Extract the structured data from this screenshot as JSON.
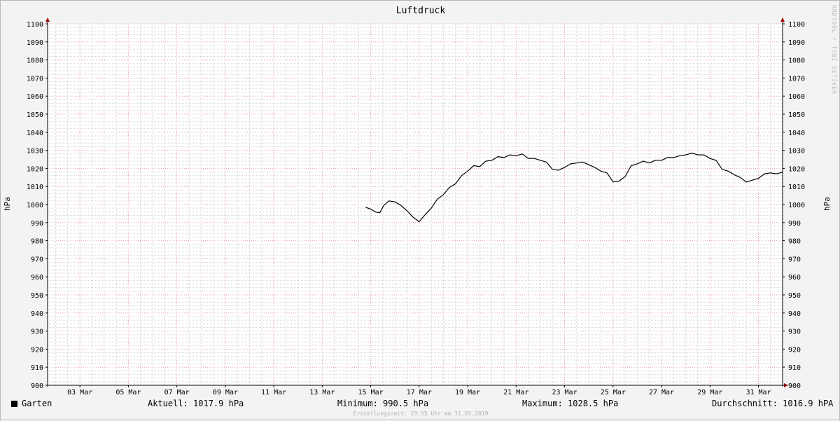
{
  "chart_data": {
    "type": "line",
    "title": "Luftdruck",
    "ylabel": "hPa",
    "ylim": [
      900,
      1100
    ],
    "yticks": [
      900,
      910,
      920,
      930,
      940,
      950,
      960,
      970,
      980,
      990,
      1000,
      1010,
      1020,
      1030,
      1040,
      1050,
      1060,
      1070,
      1080,
      1090,
      1100
    ],
    "xlim": [
      "2019-03-01 16:00",
      "2019-03-31 23:55"
    ],
    "xticks": [
      {
        "label": "03 Mar",
        "date": "2019-03-03"
      },
      {
        "label": "05 Mar",
        "date": "2019-03-05"
      },
      {
        "label": "07 Mar",
        "date": "2019-03-07"
      },
      {
        "label": "09 Mar",
        "date": "2019-03-09"
      },
      {
        "label": "11 Mar",
        "date": "2019-03-11"
      },
      {
        "label": "13 Mar",
        "date": "2019-03-13"
      },
      {
        "label": "15 Mar",
        "date": "2019-03-15"
      },
      {
        "label": "17 Mar",
        "date": "2019-03-17"
      },
      {
        "label": "19 Mar",
        "date": "2019-03-19"
      },
      {
        "label": "21 Mar",
        "date": "2019-03-21"
      },
      {
        "label": "23 Mar",
        "date": "2019-03-23"
      },
      {
        "label": "25 Mar",
        "date": "2019-03-25"
      },
      {
        "label": "27 Mar",
        "date": "2019-03-27"
      },
      {
        "label": "29 Mar",
        "date": "2019-03-29"
      },
      {
        "label": "31 Mar",
        "date": "2019-03-31"
      }
    ],
    "grid": true,
    "series": [
      {
        "name": "Garten",
        "color": "#000000",
        "points": [
          [
            "2019-03-14 19:00",
            998.5
          ],
          [
            "2019-03-15 00:00",
            997.5
          ],
          [
            "2019-03-15 05:00",
            995.8
          ],
          [
            "2019-03-15 09:00",
            995.5
          ],
          [
            "2019-03-15 13:00",
            999.5
          ],
          [
            "2019-03-15 18:00",
            1002.0
          ],
          [
            "2019-03-16 00:00",
            1001.5
          ],
          [
            "2019-03-16 06:00",
            999.5
          ],
          [
            "2019-03-16 12:00",
            996.5
          ],
          [
            "2019-03-16 18:00",
            993.0
          ],
          [
            "2019-03-17 00:00",
            990.5
          ],
          [
            "2019-03-17 06:00",
            994.5
          ],
          [
            "2019-03-17 12:00",
            998.0
          ],
          [
            "2019-03-17 18:00",
            1003.0
          ],
          [
            "2019-03-18 00:00",
            1005.5
          ],
          [
            "2019-03-18 06:00",
            1009.5
          ],
          [
            "2019-03-18 12:00",
            1011.5
          ],
          [
            "2019-03-18 18:00",
            1016.0
          ],
          [
            "2019-03-19 00:00",
            1018.5
          ],
          [
            "2019-03-19 06:00",
            1021.5
          ],
          [
            "2019-03-19 12:00",
            1021.0
          ],
          [
            "2019-03-19 18:00",
            1024.0
          ],
          [
            "2019-03-20 00:00",
            1024.5
          ],
          [
            "2019-03-20 06:00",
            1026.5
          ],
          [
            "2019-03-20 12:00",
            1026.0
          ],
          [
            "2019-03-20 18:00",
            1027.5
          ],
          [
            "2019-03-21 00:00",
            1027.0
          ],
          [
            "2019-03-21 06:00",
            1028.0
          ],
          [
            "2019-03-21 12:00",
            1025.5
          ],
          [
            "2019-03-21 18:00",
            1025.5
          ],
          [
            "2019-03-22 00:00",
            1024.5
          ],
          [
            "2019-03-22 06:00",
            1023.5
          ],
          [
            "2019-03-22 12:00",
            1019.5
          ],
          [
            "2019-03-22 18:00",
            1019.0
          ],
          [
            "2019-03-23 00:00",
            1020.5
          ],
          [
            "2019-03-23 06:00",
            1022.5
          ],
          [
            "2019-03-23 12:00",
            1023.0
          ],
          [
            "2019-03-23 18:00",
            1023.5
          ],
          [
            "2019-03-24 00:00",
            1022.0
          ],
          [
            "2019-03-24 06:00",
            1020.5
          ],
          [
            "2019-03-24 12:00",
            1018.5
          ],
          [
            "2019-03-24 18:00",
            1017.5
          ],
          [
            "2019-03-25 00:00",
            1012.5
          ],
          [
            "2019-03-25 06:00",
            1013.0
          ],
          [
            "2019-03-25 12:00",
            1015.5
          ],
          [
            "2019-03-25 18:00",
            1021.5
          ],
          [
            "2019-03-26 00:00",
            1022.5
          ],
          [
            "2019-03-26 06:00",
            1024.0
          ],
          [
            "2019-03-26 12:00",
            1023.0
          ],
          [
            "2019-03-26 18:00",
            1024.5
          ],
          [
            "2019-03-27 00:00",
            1024.5
          ],
          [
            "2019-03-27 06:00",
            1026.0
          ],
          [
            "2019-03-27 12:00",
            1026.0
          ],
          [
            "2019-03-27 18:00",
            1027.0
          ],
          [
            "2019-03-28 00:00",
            1027.5
          ],
          [
            "2019-03-28 06:00",
            1028.5
          ],
          [
            "2019-03-28 12:00",
            1027.5
          ],
          [
            "2019-03-28 18:00",
            1027.5
          ],
          [
            "2019-03-29 00:00",
            1025.5
          ],
          [
            "2019-03-29 06:00",
            1024.5
          ],
          [
            "2019-03-29 12:00",
            1019.5
          ],
          [
            "2019-03-29 18:00",
            1018.5
          ],
          [
            "2019-03-30 00:00",
            1016.5
          ],
          [
            "2019-03-30 06:00",
            1015.0
          ],
          [
            "2019-03-30 12:00",
            1012.5
          ],
          [
            "2019-03-30 18:00",
            1013.5
          ],
          [
            "2019-03-31 00:00",
            1014.5
          ],
          [
            "2019-03-31 06:00",
            1017.0
          ],
          [
            "2019-03-31 12:00",
            1017.5
          ],
          [
            "2019-03-31 18:00",
            1017.0
          ],
          [
            "2019-03-31 23:55",
            1017.9
          ]
        ]
      }
    ]
  },
  "watermark": "RRDTOOL / TOBI OETIKER",
  "legend": {
    "series_name": "Garten",
    "current": "Aktuell: 1017.9 hPa",
    "minimum": "Minimum: 990.5 hPa",
    "maximum": "Maximum: 1028.5 hPa",
    "average": "Durchschnitt: 1016.9 hPA"
  },
  "footer": "Erstellungszeit: 23:55 Uhr am 31.03.2019",
  "colors": {
    "background": "#f3f3f3",
    "plot_background": "#ffffff",
    "major_grid": "#e8a0b0",
    "minor_grid": "#d6d6d6",
    "axis": "#000000",
    "arrow": "#a00000",
    "line": "#000000"
  }
}
